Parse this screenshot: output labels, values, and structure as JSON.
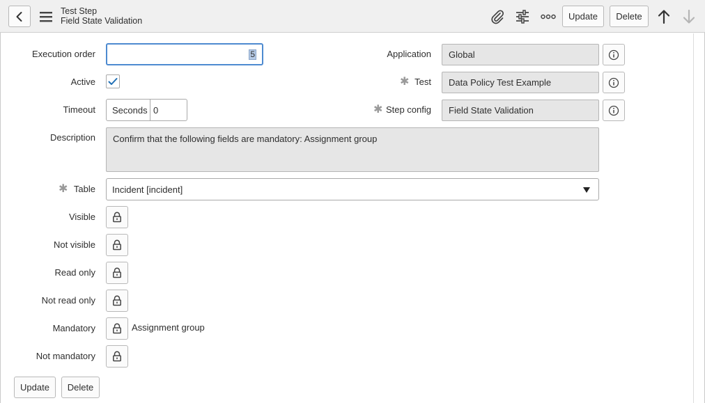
{
  "header": {
    "title": "Test Step",
    "subtitle": "Field State Validation",
    "update_label": "Update",
    "delete_label": "Delete"
  },
  "form": {
    "execution_order": {
      "label": "Execution order",
      "value": "5"
    },
    "active": {
      "label": "Active",
      "checked": true
    },
    "timeout": {
      "label": "Timeout",
      "unit": "Seconds",
      "value": "0"
    },
    "description": {
      "label": "Description",
      "value": "Confirm that the following fields are mandatory: Assignment group"
    },
    "table": {
      "label": "Table",
      "value": "Incident [incident]"
    },
    "application": {
      "label": "Application",
      "value": "Global"
    },
    "test": {
      "label": "Test",
      "value": "Data Policy Test Example"
    },
    "step_config": {
      "label": "Step config",
      "value": "Field State Validation"
    },
    "visible": {
      "label": "Visible",
      "value": ""
    },
    "not_visible": {
      "label": "Not visible",
      "value": ""
    },
    "read_only": {
      "label": "Read only",
      "value": ""
    },
    "not_read_only": {
      "label": "Not read only",
      "value": ""
    },
    "mandatory": {
      "label": "Mandatory",
      "value": "Assignment group"
    },
    "not_mandatory": {
      "label": "Not mandatory",
      "value": ""
    }
  },
  "footer": {
    "update_label": "Update",
    "delete_label": "Delete"
  },
  "colors": {
    "accent": "#1f6fb5",
    "focus_border": "#4d8ad0",
    "readonly_bg": "#e6e6e6"
  }
}
